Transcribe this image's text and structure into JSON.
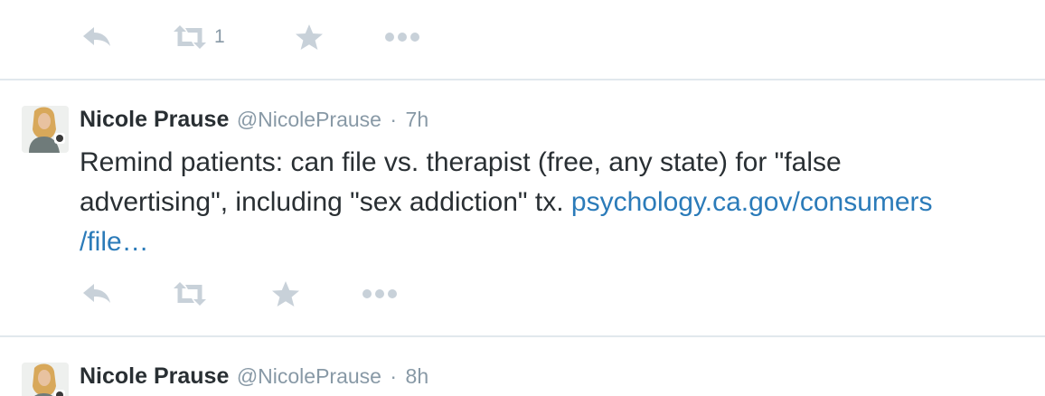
{
  "colors": {
    "text": "#292f33",
    "secondary": "#8899a6",
    "link": "#2b7bb9",
    "icon": "#c8d1d9",
    "divider": "#e1e8ed"
  },
  "top_actions": {
    "icons": [
      "reply-icon",
      "retweet-icon",
      "favorite-icon",
      "more-icon"
    ],
    "retweet_count": "1"
  },
  "tweets": [
    {
      "avatar": "avatar-photo",
      "fullname": "Nicole Prause",
      "username": "@NicolePrause",
      "separator": "·",
      "time": "7h",
      "text_line1": "Remind patients: can file vs. therapist (free, any state) for \"false",
      "text_line2_plain": "advertising\", including \"sex addiction\" tx. ",
      "text_line2_link": "psychology.ca.gov/consumers",
      "text_line3_link": "/file…",
      "actions": {
        "icons": [
          "reply-icon",
          "retweet-icon",
          "favorite-icon",
          "more-icon"
        ]
      }
    },
    {
      "avatar": "avatar-photo",
      "fullname": "Nicole Prause",
      "username": "@NicolePrause",
      "separator": "·",
      "time": "8h"
    }
  ]
}
